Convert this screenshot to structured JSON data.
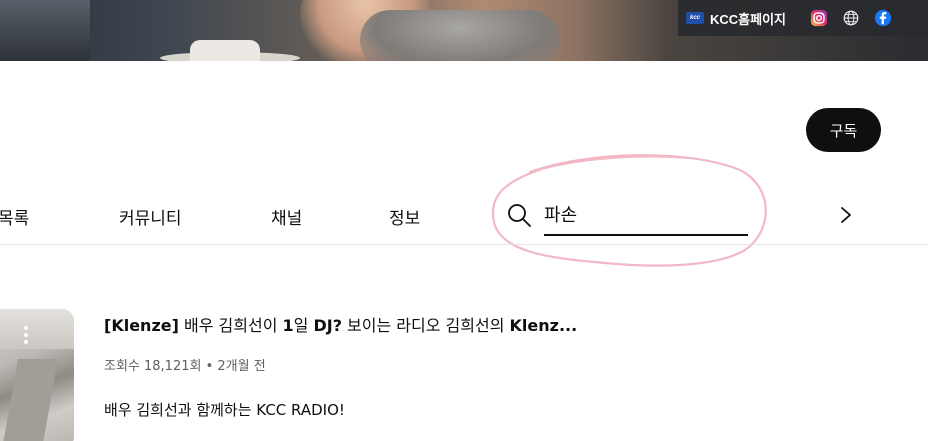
{
  "banner": {
    "kcc_link_label": "KCC홈페이지",
    "kcc_logo_text": "kcc",
    "social_icons": [
      "instagram-icon",
      "globe-icon",
      "facebook-icon"
    ]
  },
  "subscribe_label": "구독",
  "tabs": [
    {
      "label": "재생목록",
      "visible_label": "목록"
    },
    {
      "label": "커뮤니티"
    },
    {
      "label": "채널"
    },
    {
      "label": "정보"
    }
  ],
  "search": {
    "value": "파손",
    "icon": "search-icon"
  },
  "colors": {
    "highlight_ring": "#f2b8c6",
    "subscribe_bg": "#0f0f0f",
    "meta_text": "#606060"
  },
  "video": {
    "title_bracket": "[Klenze]",
    "title_part1": " 배우 김희선이 ",
    "title_bold1": "1",
    "title_part2": "일 ",
    "title_bold2": "DJ?",
    "title_part3": " 보이는 라디오 김희선의 ",
    "title_bold3": "Klenz...",
    "meta": "조회수 18,121회 • 2개월 전",
    "description": "배우 김희선과 함께하는 KCC RADIO!"
  }
}
